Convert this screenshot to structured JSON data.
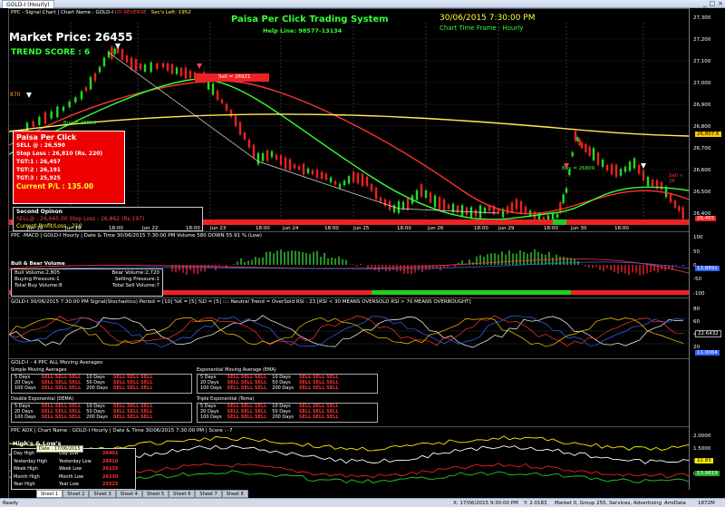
{
  "window": {
    "tab_title": "GOLD-I (Hourly)",
    "controls": [
      "_",
      "□",
      "×"
    ]
  },
  "main_chart": {
    "header_left": "PPC - Signal Chart",
    "chart_name": "Chart Name : GOLD-I",
    "reverse_label": "I/D REVERSE",
    "secs_left": "Sec's Left:  1952",
    "system_title": "Paisa Per Click Trading System",
    "helpline": "Help Line:  98577-13134",
    "datetime": "30/06/2015 7:30:00 PM",
    "timeframe": "Chart Time Frame : Hourly",
    "market_price_label": "Market Price:",
    "market_price": "26455",
    "trend_score": "TREND SCORE : 6",
    "price_ticks": [
      "27,300",
      "27,200",
      "27,100",
      "27,000",
      "26,900",
      "26,800",
      "26,700",
      "26,600",
      "26,500",
      "26,400"
    ],
    "current_price_tag": "26,807.6",
    "last_price_tag": "26,455",
    "x_labels": [
      "Jun 18",
      "Jun 19",
      "18:00",
      "Jun 22",
      "18:00",
      "Jun 23",
      "18:00",
      "Jun 24",
      "18:00",
      "Jun 25",
      "18:00",
      "Jun 26",
      "18:00",
      "Jun 29",
      "18:00",
      "Jun 30",
      "18:00"
    ],
    "annotations": {
      "sell_tag": "Sell = 26921",
      "buy_tag_1": "Buy = 26896",
      "buy_tag_2": "Buy = 26809",
      "sell_tag_2": "Sell < 26",
      "left_mark": "870"
    },
    "ppc_box": {
      "title": "Paisa Per Click",
      "sell": "SELL @ : 26,590",
      "stop_loss": "Stop Loss : 26,810 (Rs. 220)",
      "tgt1": "TGT:1 : 26,457",
      "tgt2": "TGT:2 : 26,191",
      "tgt3": "TGT:3 : 25,925",
      "current_pl": "Current P/L : 135.00"
    },
    "second_box": {
      "title": "Second Opinon",
      "line1": "SELL@ : 26,665.00   Stop Loss : 26,862  (Rs.197)",
      "line2": "Current Profit/Loss : 210"
    }
  },
  "macd_pane": {
    "header": "PPC -MACD | GOLD-I Hourly | Date & Time  30/06/2015 7:30:00 PM  Volume  580   DOWN  55.91 %  (Low)",
    "title": "Bull & Bear Volume",
    "bull_volume": "Bull Volume:2,805",
    "bear_volume": "Bear Volume:2,720",
    "buying_pressure": "Buying Pressure:1",
    "selling_pressure": "Selling Pressure:1",
    "total_buy": "Total Buy Volume:8",
    "total_sell": "Total Sell Volume:7",
    "ticks": [
      "100",
      "50",
      "0",
      "-50",
      "-100"
    ],
    "tag": "13.8892"
  },
  "stoch_pane": {
    "header": "GOLD-I   30/06/2015 7:30:00 PM    Signal(Stochastics) Period = [10]    %K = [5]    %D = [5]  ::::  Neutral   Trend = OverSold    RSI : 23   [RSI < 30  MEANS OVERSOLD  RSI > 70  MEANS OVERBOUGHT]",
    "ticks": [
      "80",
      "60",
      "40",
      "20"
    ],
    "tag1": "22.6432",
    "tag2": "11.0064"
  },
  "ma_pane": {
    "header": "GOLD-I - 4 PPC ALL Moving Averages",
    "sections": [
      {
        "title": "Simple Moving Averages",
        "rows": [
          [
            "5 Days",
            "SELL SELL SELL",
            "10 Days",
            "SELL SELL SELL"
          ],
          [
            "20 Days",
            "SELL SELL SELL",
            "50 Days",
            "SELL SELL SELL"
          ],
          [
            "100 Days",
            "SELL SELL SELL",
            "200 Days",
            "SELL SELL SELL"
          ]
        ]
      },
      {
        "title": "Exponential Moving Average (EMA)",
        "rows": [
          [
            "5 Days",
            "SELL SELL SELL",
            "10 Days",
            "SELL SELL SELL"
          ],
          [
            "20 Days",
            "SELL SELL SELL",
            "50 Days",
            "SELL SELL SELL"
          ],
          [
            "100 Days",
            "SELL SELL SELL",
            "200 Days",
            "SELL SELL SELL"
          ]
        ]
      },
      {
        "title": "Double Exponential (DEMA)",
        "rows": [
          [
            "5 Days",
            "SELL SELL SELL",
            "10 Days",
            "SELL SELL SELL"
          ],
          [
            "20 Days",
            "SELL SELL SELL",
            "50 Days",
            "SELL SELL SELL"
          ],
          [
            "100 Days",
            "SELL SELL SELL",
            "200 Days",
            "SELL SELL SELL"
          ]
        ]
      },
      {
        "title": "Triple Exponential (Tema)",
        "rows": [
          [
            "5 Days",
            "SELL SELL SELL",
            "10 Days",
            "SELL SELL SELL"
          ],
          [
            "20 Days",
            "SELL SELL SELL",
            "50 Days",
            "SELL SELL SELL"
          ],
          [
            "100 Days",
            "SELL SELL SELL",
            "200 Days",
            "SELL SELL SELL"
          ]
        ]
      }
    ]
  },
  "adx_pane": {
    "header": "PPC ADX  | Chart Name : GOLD-I  Hourly | Date & Time  30/06/2015 7:30:00 PM  | Score : -7",
    "hl_title": "High's & Low's",
    "hl_rows": [
      [
        "Day High",
        "",
        "Day Low",
        "26401"
      ],
      [
        "Yesterday High",
        "",
        "Yesterday Low",
        "26610"
      ],
      [
        "Week High",
        "",
        "Week Low",
        "26135"
      ],
      [
        "Month High",
        "",
        "Month Low",
        "26230"
      ],
      [
        "Year High",
        "",
        "Year Low",
        "25525"
      ]
    ],
    "tooltip": "Date : 17/06/2015",
    "ticks": [
      "2.0000",
      "1.5000",
      "1.0000",
      "0.5000"
    ],
    "tag1": "22.83",
    "tag2": "13.9819"
  },
  "sheets": [
    "Sheet 1",
    "Sheet 2",
    "Sheet 3",
    "Sheet 4",
    "Sheet 5",
    "Sheet 6",
    "Sheet 7",
    "Sheet 8"
  ],
  "statusbar": {
    "ready": "Ready",
    "coords": "X: 17/06/2015 9:30:00 PM",
    "yval": "Y: 2.0183",
    "market": "Market 0, Group 255, Services, Advertising",
    "app": "AmiData",
    "mem": "1872M"
  },
  "colors": {
    "up": "#22dd22",
    "down": "#ee2222",
    "ma_red": "#ff3333",
    "ma_green": "#33ff33",
    "ma_yellow": "#ffee55",
    "title_green": "#33ff33"
  }
}
